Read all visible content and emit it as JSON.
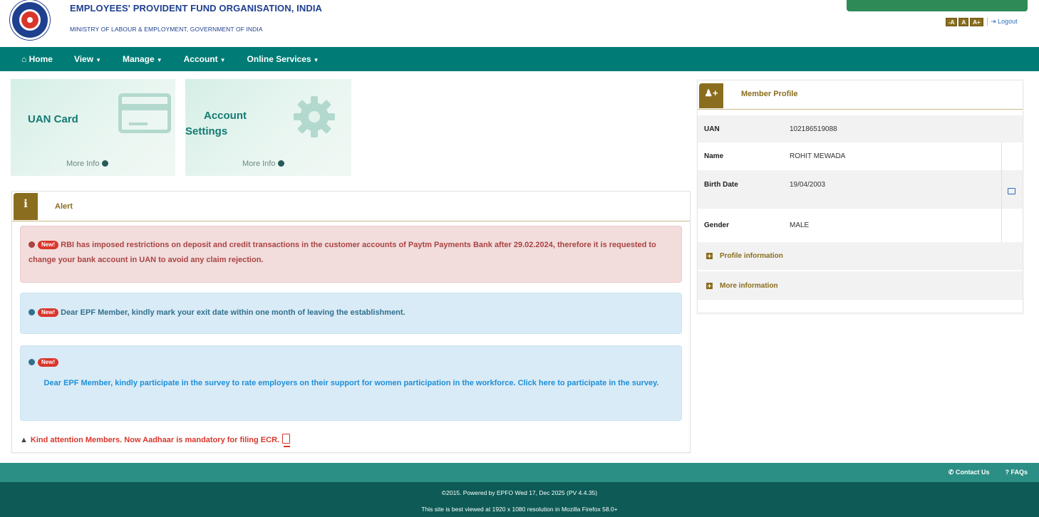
{
  "header": {
    "org_name": "EMPLOYEES' PROVIDENT FUND ORGANISATION, INDIA",
    "ministry": "MINISTRY OF LABOUR & EMPLOYMENT, GOVERNMENT OF INDIA",
    "font_buttons": [
      "-A",
      "A",
      "A+"
    ],
    "logout_label": "Logout"
  },
  "nav": {
    "items": [
      {
        "label": "Home",
        "icon": "home-icon",
        "dropdown": false
      },
      {
        "label": "View",
        "dropdown": true
      },
      {
        "label": "Manage",
        "dropdown": true
      },
      {
        "label": "Account",
        "dropdown": true
      },
      {
        "label": "Online Services",
        "dropdown": true
      }
    ]
  },
  "tiles": [
    {
      "title": "UAN Card",
      "more": "More Info",
      "icon": "id-card-icon"
    },
    {
      "title_line1": "Account",
      "title_line2": "Settings",
      "more": "More Info",
      "icon": "gear-icon"
    }
  ],
  "alert": {
    "title": "Alert",
    "new_label": "New!",
    "messages": [
      {
        "text": "RBI has imposed restrictions on deposit and credit transactions in the customer accounts of Paytm Payments Bank after 29.02.2024, therefore it is requested to change your bank account in UAN to avoid any claim rejection."
      },
      {
        "text": "Dear EPF Member, kindly mark your exit date within one month of leaving the establishment."
      },
      {
        "text": "Dear EPF Member, kindly participate in the survey to rate employers on their support for women participation in the workforce. Click here to participate in the survey."
      }
    ],
    "kind_attention": "Kind attention Members. Now Aadhaar is mandatory for filing ECR."
  },
  "profile": {
    "title": "Member Profile",
    "rows": [
      {
        "label": "UAN",
        "value": "102186519088"
      },
      {
        "label": "Name",
        "value": "ROHIT MEWADA"
      },
      {
        "label": "Birth Date",
        "value": "19/04/2003"
      },
      {
        "label": "Gender",
        "value": "MALE"
      }
    ],
    "sections": [
      "Profile information",
      "More information"
    ]
  },
  "footer": {
    "contact": "Contact Us",
    "faqs": "FAQs",
    "powered": "©2015. Powered by EPFO Wed 17, Dec 2025 (PV 4.4.35)",
    "best_viewed": "This site is best viewed at 1920 x 1080 resolution in Mozilla Firefox 58.0+"
  },
  "colors": {
    "nav_bg": "#007b75",
    "accent_gold": "#8a6d1e",
    "danger_text": "#a94442",
    "info_text": "#31708f",
    "footer_bg": "#0d5a56"
  }
}
